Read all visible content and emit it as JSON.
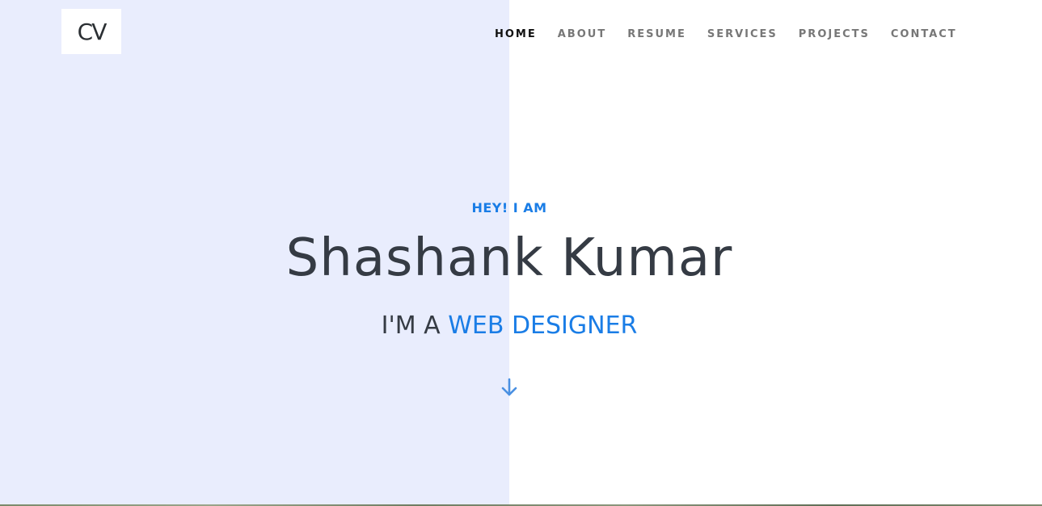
{
  "logo": {
    "text": "CV"
  },
  "nav": {
    "items": [
      {
        "label": "HOME",
        "active": true
      },
      {
        "label": "ABOUT",
        "active": false
      },
      {
        "label": "RESUME",
        "active": false
      },
      {
        "label": "SERVICES",
        "active": false
      },
      {
        "label": "PROJECTS",
        "active": false
      },
      {
        "label": "CONTACT",
        "active": false
      }
    ]
  },
  "hero": {
    "eyebrow": "HEY! I AM",
    "name": "Shashank Kumar",
    "role_prefix": "I'M A",
    "role_highlight": "WEB DESIGNER",
    "scroll_icon": "arrow-down-icon"
  },
  "colors": {
    "accent": "#1a7de6",
    "text_dark": "#353b44",
    "left_panel": "#e9edfd",
    "nav_inactive": "#777777",
    "nav_active": "#111111"
  }
}
